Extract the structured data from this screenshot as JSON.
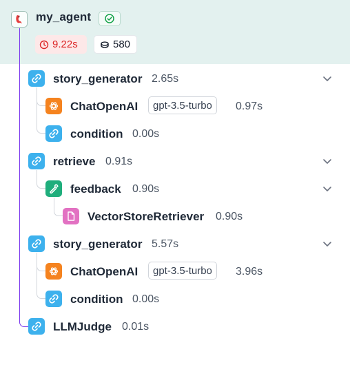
{
  "root": {
    "title": "my_agent",
    "icon": "parrot-icon",
    "status": "check-circle-icon",
    "latency": "9.22s",
    "tokens": "580",
    "accent": "#e3f1ef"
  },
  "nodes": [
    {
      "label": "story_generator",
      "duration": "2.65s",
      "icon": "link-icon",
      "expandable": true
    },
    {
      "label": "ChatOpenAI",
      "model": "gpt-3.5-turbo",
      "duration": "0.97s",
      "icon": "openai-icon"
    },
    {
      "label": "condition",
      "duration": "0.00s",
      "icon": "link-icon"
    },
    {
      "label": "retrieve",
      "duration": "0.91s",
      "icon": "link-icon",
      "expandable": true
    },
    {
      "label": "feedback",
      "duration": "0.90s",
      "icon": "wrench-icon",
      "expandable": true
    },
    {
      "label": "VectorStoreRetriever",
      "duration": "0.90s",
      "icon": "document-icon"
    },
    {
      "label": "story_generator",
      "duration": "5.57s",
      "icon": "link-icon",
      "expandable": true
    },
    {
      "label": "ChatOpenAI",
      "model": "gpt-3.5-turbo",
      "duration": "3.96s",
      "icon": "openai-icon"
    },
    {
      "label": "condition",
      "duration": "0.00s",
      "icon": "link-icon"
    },
    {
      "label": "LLMJudge",
      "duration": "0.01s",
      "icon": "link-icon"
    }
  ]
}
